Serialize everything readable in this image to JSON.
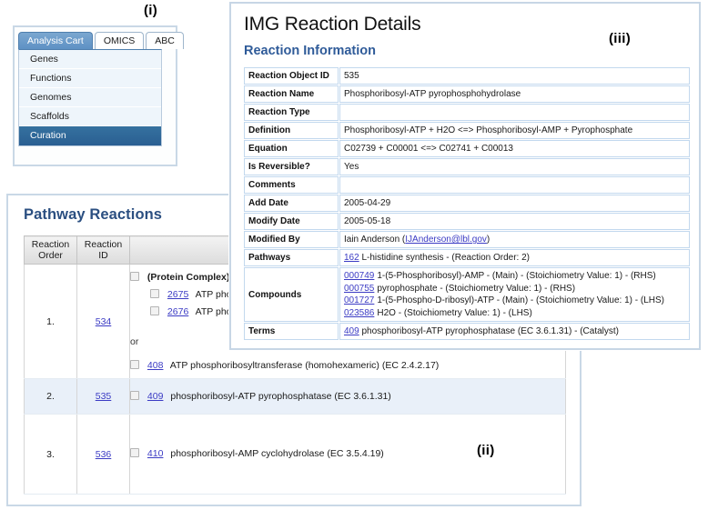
{
  "figure_labels": {
    "i": "(i)",
    "ii": "(ii)",
    "iii": "(iii)"
  },
  "analysis_cart": {
    "tabs": [
      {
        "label": "Analysis Cart",
        "active": true
      },
      {
        "label": "OMICS",
        "active": false
      },
      {
        "label": "ABC",
        "active": false
      }
    ],
    "items": [
      {
        "label": "Genes",
        "selected": false
      },
      {
        "label": "Functions",
        "selected": false
      },
      {
        "label": "Genomes",
        "selected": false
      },
      {
        "label": "Scaffolds",
        "selected": false
      },
      {
        "label": "Curation",
        "selected": true
      }
    ]
  },
  "pathway_reactions": {
    "title": "Pathway Reactions",
    "columns": [
      "Reaction\nOrder",
      "Reaction\nID",
      ""
    ],
    "column_order": "Reaction Order",
    "column_id": "Reaction ID",
    "rows": [
      {
        "order": "1.",
        "id": "534",
        "protein_complex_label": "(Protein Complex)",
        "complex_members": [
          {
            "id": "2675",
            "name": "ATP pho"
          },
          {
            "id": "2676",
            "name": "ATP pho"
          }
        ],
        "or_label": "or",
        "alternative": {
          "id": "408",
          "name": "ATP phosphoribosyltransferase (homohexameric) (EC 2.4.2.17)"
        }
      },
      {
        "order": "2.",
        "id": "535",
        "alternative": {
          "id": "409",
          "name": "phosphoribosyl-ATP pyrophosphatase (EC 3.6.1.31)"
        }
      },
      {
        "order": "3.",
        "id": "536",
        "alternative": {
          "id": "410",
          "name": "phosphoribosyl-AMP cyclohydrolase (EC 3.5.4.19)"
        }
      }
    ]
  },
  "img_reaction_details": {
    "title": "IMG Reaction Details",
    "subtitle": "Reaction Information",
    "fields": [
      {
        "key": "Reaction Object ID",
        "value": "535"
      },
      {
        "key": "Reaction Name",
        "value": "Phosphoribosyl-ATP pyrophosphohydrolase"
      },
      {
        "key": "Reaction Type",
        "value": ""
      },
      {
        "key": "Definition",
        "value": "Phosphoribosyl-ATP + H2O <=> Phosphoribosyl-AMP + Pyrophosphate"
      },
      {
        "key": "Equation",
        "value": "C02739 + C00001 <=> C02741 + C00013"
      },
      {
        "key": "Is Reversible?",
        "value": "Yes"
      },
      {
        "key": "Comments",
        "value": ""
      },
      {
        "key": "Add Date",
        "value": "2005-04-29"
      },
      {
        "key": "Modify Date",
        "value": "2005-05-18"
      }
    ],
    "modified_by": {
      "key": "Modified By",
      "person": "Iain Anderson (",
      "email": "IJAnderson@lbl.gov",
      "suffix": ")"
    },
    "pathways": {
      "key": "Pathways",
      "id": "162",
      "text": "L-histidine synthesis - (Reaction Order: 2)"
    },
    "compounds": {
      "key": "Compounds",
      "entries": [
        {
          "id": "000749",
          "text": "1-(5-Phosphoribosyl)-AMP - (Main) - (Stoichiometry Value: 1) - (RHS)"
        },
        {
          "id": "000755",
          "text": "pyrophosphate - (Stoichiometry Value: 1) - (RHS)"
        },
        {
          "id": "001727",
          "text": "1-(5-Phospho-D-ribosyl)-ATP - (Main) - (Stoichiometry Value: 1) - (LHS)"
        },
        {
          "id": "023586",
          "text": "H2O - (Stoichiometry Value: 1) - (LHS)"
        }
      ]
    },
    "terms": {
      "key": "Terms",
      "id": "409",
      "text": "phosphoribosyl-ATP pyrophosphatase (EC 3.6.1.31) - (Catalyst)"
    }
  },
  "colors": {
    "link": "#3b3bc4",
    "heading_blue": "#2b4f81",
    "tab_active": "#6d9dcb",
    "item_selected": "#2f6da8",
    "table_border_blue": "#c2d8ee",
    "alt_row": "#e9f0f9"
  }
}
